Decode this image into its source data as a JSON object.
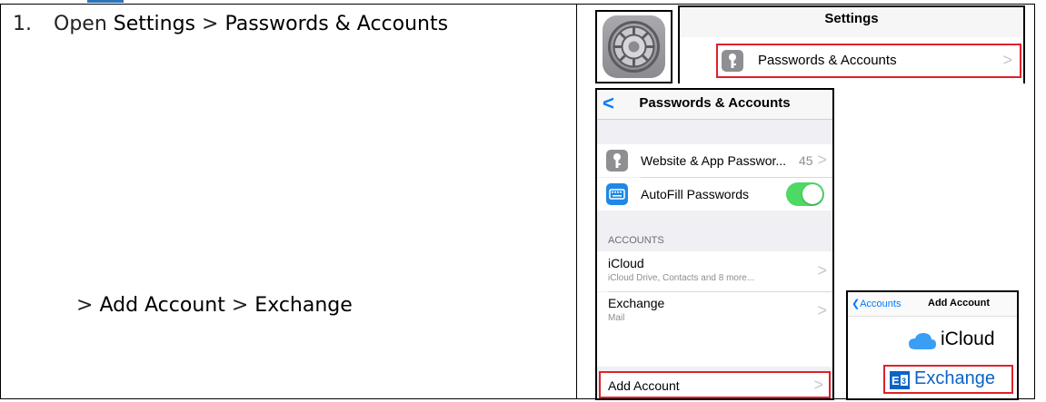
{
  "doc": {
    "step_number": "1.",
    "step_open": "Open",
    "step_settings": "Settings",
    "step_sep1": ">",
    "step_passwords": "Passwords & Accounts",
    "step2_sep1": ">",
    "step2_add": "Add Account",
    "step2_sep2": ">",
    "step2_exchange": "Exchange"
  },
  "settings_panel": {
    "title": "Settings",
    "row_label": "Passwords & Accounts",
    "chevron": ">"
  },
  "phone": {
    "back_icon": "<",
    "title": "Passwords & Accounts",
    "website_row": {
      "label": "Website & App Passwor...",
      "count": "45",
      "chevron": ">"
    },
    "autofill_row": {
      "label": "AutoFill Passwords",
      "toggle_on": true
    },
    "accounts_header": "ACCOUNTS",
    "icloud": {
      "title": "iCloud",
      "subtitle": "iCloud Drive, Contacts and 8 more...",
      "chevron": ">"
    },
    "exchange": {
      "title": "Exchange",
      "subtitle": "Mail",
      "chevron": ">"
    },
    "add_account": {
      "label": "Add Account",
      "chevron": ">"
    }
  },
  "add_account_panel": {
    "back_label": "Accounts",
    "title": "Add Account",
    "icloud_label": "iCloud",
    "exchange_label": "Exchange"
  },
  "colors": {
    "highlight": "#e0202a",
    "ios_blue": "#007aff",
    "toggle_green": "#4cd964",
    "exchange_blue": "#0a64c8"
  }
}
